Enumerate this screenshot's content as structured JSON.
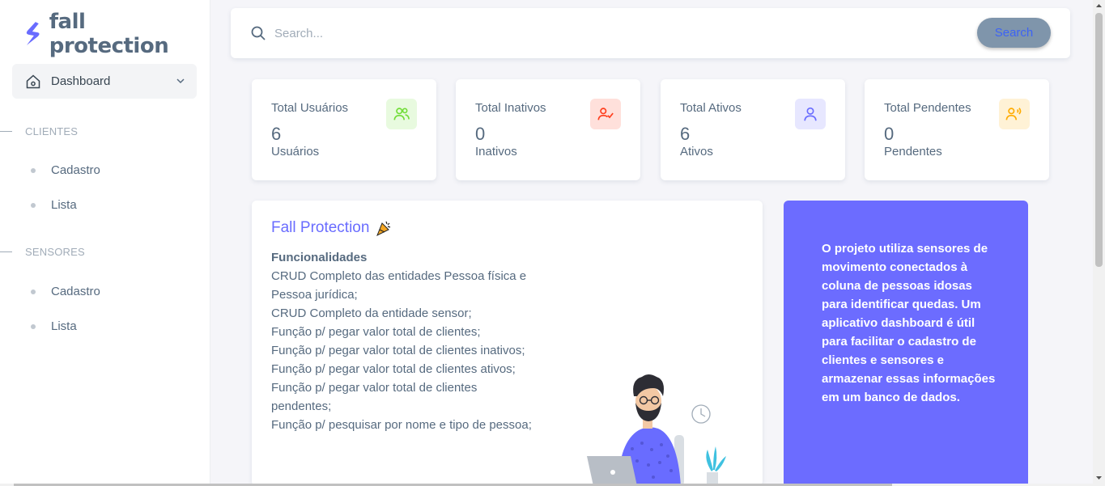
{
  "brand": {
    "name": "fall protection",
    "logo_icon": "brand-s-logo",
    "accent": "#696cff"
  },
  "sidebar": {
    "active_item": {
      "label": "Dashboard",
      "icon": "home-icon"
    },
    "sections": [
      {
        "header": "CLIENTES",
        "items": [
          {
            "label": "Cadastro"
          },
          {
            "label": "Lista"
          }
        ]
      },
      {
        "header": "SENSORES",
        "items": [
          {
            "label": "Cadastro"
          },
          {
            "label": "Lista"
          }
        ]
      }
    ]
  },
  "search": {
    "placeholder": "Search...",
    "button_label": "Search"
  },
  "stats": [
    {
      "label": "Total Usuários",
      "value": "6",
      "unit": "Usuários",
      "icon": "users-icon",
      "icon_bg": "#e8fadf",
      "icon_color": "#71dd37"
    },
    {
      "label": "Total Inativos",
      "value": "0",
      "unit": "Inativos",
      "icon": "user-check-icon",
      "icon_bg": "#ffe0db",
      "icon_color": "#ff3e1d"
    },
    {
      "label": "Total Ativos",
      "value": "6",
      "unit": "Ativos",
      "icon": "user-icon",
      "icon_bg": "#e7e7ff",
      "icon_color": "#696cff"
    },
    {
      "label": "Total Pendentes",
      "value": "0",
      "unit": "Pendentes",
      "icon": "user-voice-icon",
      "icon_bg": "#fff2d6",
      "icon_color": "#ffab00"
    }
  ],
  "main_card": {
    "title": "Fall Protection",
    "title_icon": "party-popper-icon",
    "features_heading": "Funcionalidades",
    "features": [
      "CRUD Completo das entidades Pessoa física e Pessoa jurídica;",
      "CRUD Completo da entidade sensor;",
      "Função p/ pegar valor total de clientes;",
      "Função p/ pegar valor total de clientes inativos;",
      "Função p/ pegar valor total de clientes ativos;",
      "Função p/ pegar valor total de clientes pendentes;",
      "Função p/ pesquisar por nome e tipo de pessoa;"
    ]
  },
  "info_card": {
    "text": "O projeto utiliza sensores de movimento conectados à coluna de pessoas idosas para identificar quedas. Um aplicativo dashboard é útil para facilitar o cadastro de clientes e sensores e armazenar essas informações em um banco de dados.",
    "background": "#6c6cff"
  }
}
